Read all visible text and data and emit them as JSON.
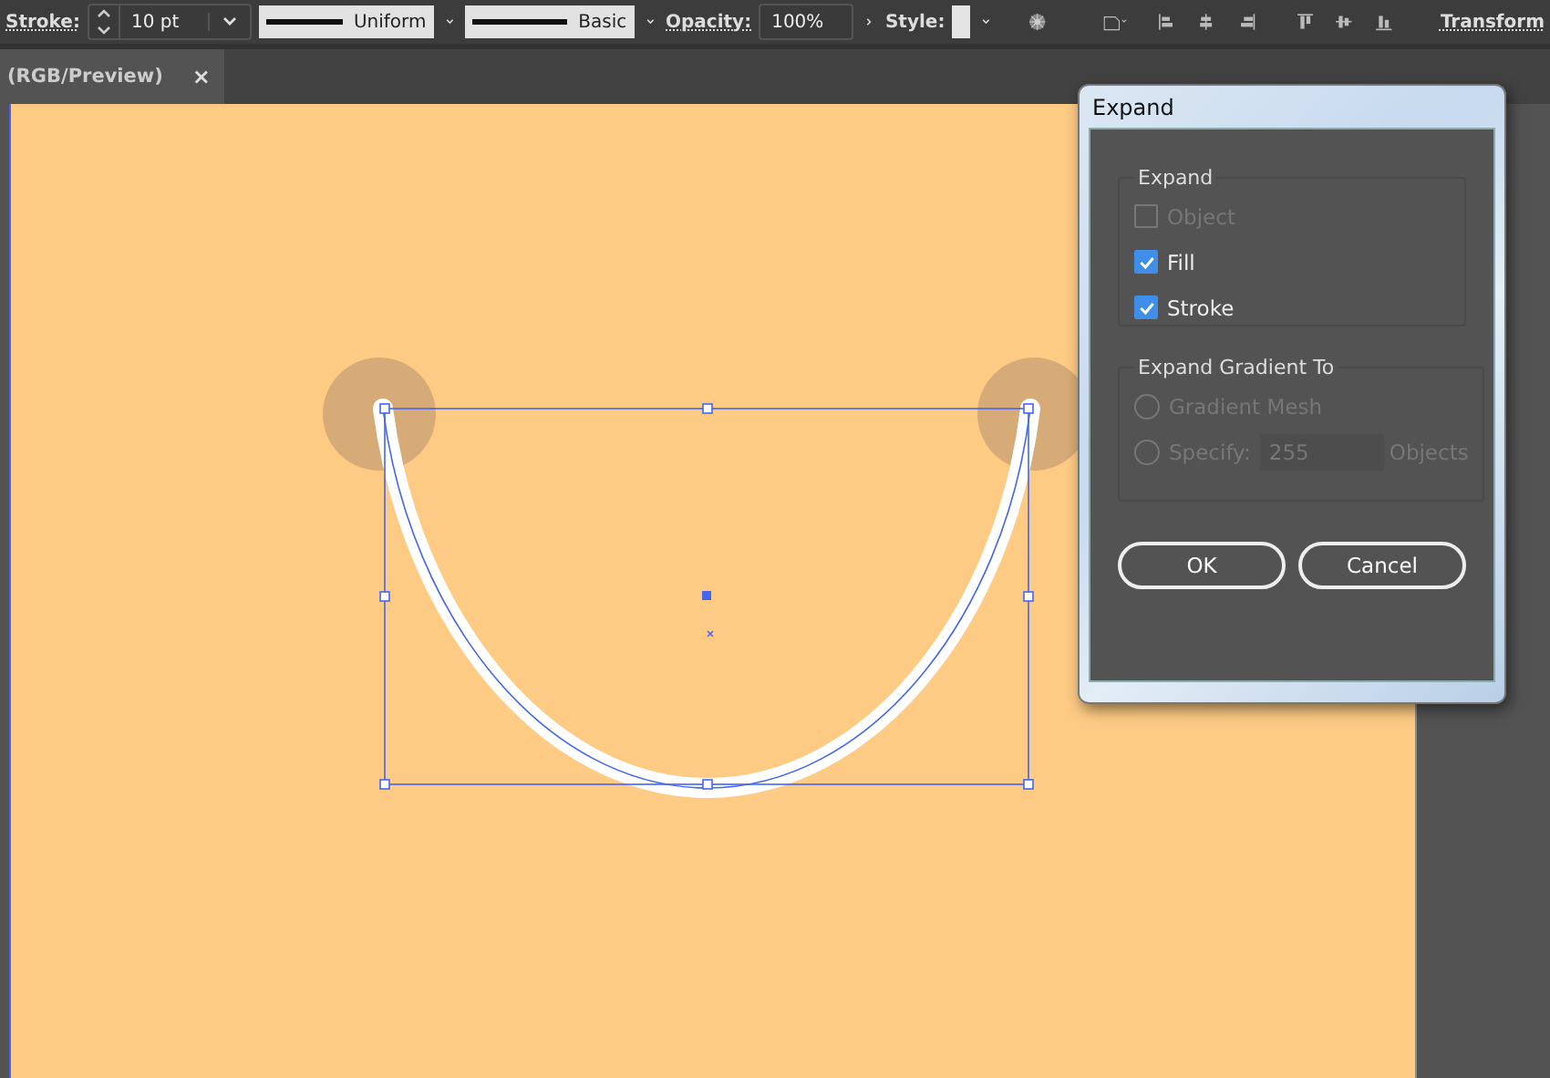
{
  "control_bar": {
    "stroke_label": "Stroke:",
    "stroke_weight": "10 pt",
    "profile": "Uniform",
    "brush": "Basic",
    "opacity_label": "Opacity:",
    "opacity": "100%",
    "style_label": "Style:",
    "transform_label": "Transform"
  },
  "tabs": [
    {
      "label": "(RGB/Preview)",
      "selected": true
    }
  ],
  "tab_close": "×",
  "dialog": {
    "title": "Expand",
    "expand_group": {
      "title": "Expand",
      "options": [
        {
          "label": "Object",
          "checked": false,
          "disabled": true
        },
        {
          "label": "Fill",
          "checked": true,
          "disabled": false
        },
        {
          "label": "Stroke",
          "checked": true,
          "disabled": false
        }
      ]
    },
    "gradient_group": {
      "title": "Expand Gradient To",
      "options": [
        {
          "label": "Gradient Mesh",
          "selected": false,
          "disabled": true
        },
        {
          "label": "Specify:",
          "selected": false,
          "disabled": true,
          "value": "255",
          "suffix": "Objects"
        }
      ]
    },
    "buttons": [
      "OK",
      "Cancel"
    ]
  }
}
